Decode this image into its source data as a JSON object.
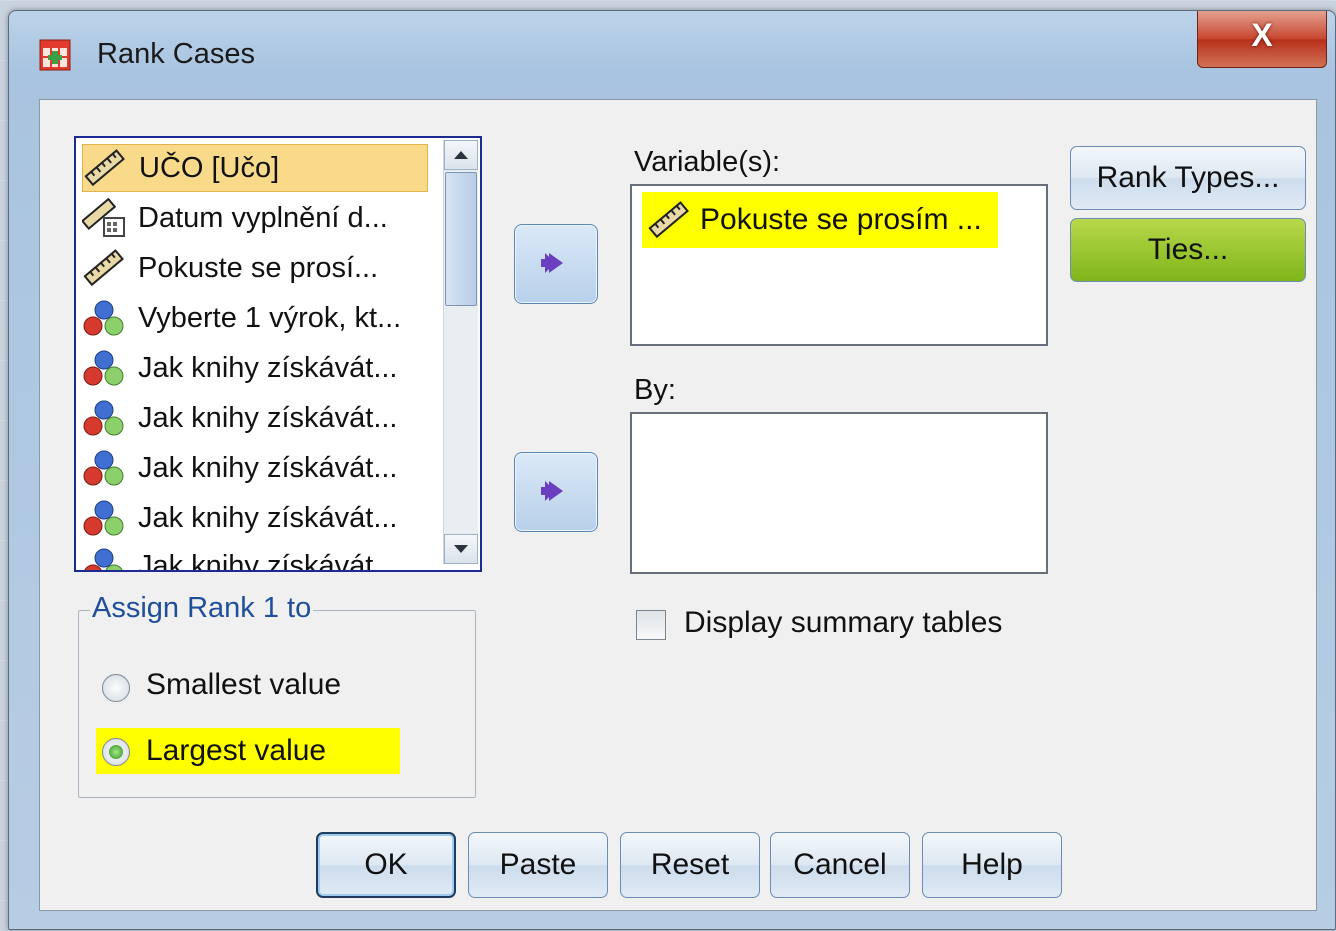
{
  "window": {
    "title": "Rank Cases",
    "close_label": "X"
  },
  "source_list": {
    "items": [
      {
        "label": "UČO [Učo]",
        "icon": "ruler-icon",
        "selected": true
      },
      {
        "label": "Datum vyplnění d...",
        "icon": "date-scale-icon"
      },
      {
        "label": "Pokuste se prosí...",
        "icon": "ruler-icon"
      },
      {
        "label": "Vyberte 1 výrok, kt...",
        "icon": "nominal-icon"
      },
      {
        "label": "Jak knihy získávát...",
        "icon": "nominal-icon"
      },
      {
        "label": "Jak knihy získávát...",
        "icon": "nominal-icon"
      },
      {
        "label": "Jak knihy získávát...",
        "icon": "nominal-icon"
      },
      {
        "label": "Jak knihy získávát...",
        "icon": "nominal-icon"
      },
      {
        "label": "Jak knihy získávát...",
        "icon": "nominal-icon"
      }
    ]
  },
  "variables": {
    "label": "Variable(s):",
    "items": [
      {
        "label": "Pokuste se prosím ...",
        "icon": "ruler-icon"
      }
    ]
  },
  "by": {
    "label": "By:"
  },
  "display_summary": {
    "label": "Display summary tables",
    "checked": false
  },
  "assign_rank": {
    "legend": "Assign Rank 1 to",
    "options": [
      {
        "label": "Smallest value",
        "selected": false
      },
      {
        "label": "Largest value",
        "selected": true
      }
    ]
  },
  "side_buttons": {
    "rank_types": "Rank Types...",
    "ties": "Ties..."
  },
  "bottom_buttons": {
    "ok": "OK",
    "paste": "Paste",
    "reset": "Reset",
    "cancel": "Cancel",
    "help": "Help"
  },
  "colors": {
    "highlight": "#ffff00",
    "selection": "#f9da8a",
    "ties_button": "#8cc22a"
  }
}
